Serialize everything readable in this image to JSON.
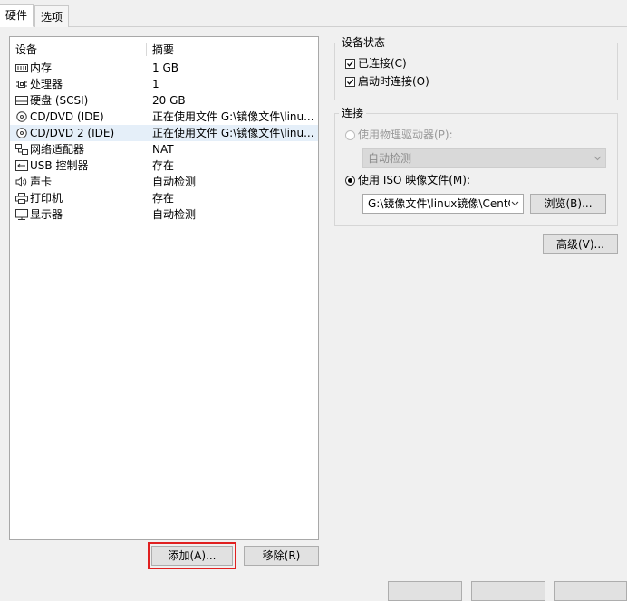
{
  "tabs": [
    {
      "label": "硬件",
      "active": true
    },
    {
      "label": "选项",
      "active": false
    }
  ],
  "device_list": {
    "columns": [
      "设备",
      "摘要"
    ],
    "rows": [
      {
        "icon": "memory-icon",
        "name": "内存",
        "summary": "1 GB",
        "selected": false
      },
      {
        "icon": "cpu-icon",
        "name": "处理器",
        "summary": "1",
        "selected": false
      },
      {
        "icon": "hard-disk-icon",
        "name": "硬盘 (SCSI)",
        "summary": "20 GB",
        "selected": false
      },
      {
        "icon": "cd-dvd-icon",
        "name": "CD/DVD (IDE)",
        "summary": "正在使用文件 G:\\镜像文件\\linu...",
        "selected": false
      },
      {
        "icon": "cd-dvd-icon",
        "name": "CD/DVD 2 (IDE)",
        "summary": "正在使用文件 G:\\镜像文件\\linu...",
        "selected": true
      },
      {
        "icon": "network-adapter-icon",
        "name": "网络适配器",
        "summary": "NAT",
        "selected": false
      },
      {
        "icon": "usb-icon",
        "name": "USB 控制器",
        "summary": "存在",
        "selected": false
      },
      {
        "icon": "sound-card-icon",
        "name": "声卡",
        "summary": "自动检测",
        "selected": false
      },
      {
        "icon": "printer-icon",
        "name": "打印机",
        "summary": "存在",
        "selected": false
      },
      {
        "icon": "display-icon",
        "name": "显示器",
        "summary": "自动检测",
        "selected": false
      }
    ]
  },
  "buttons": {
    "add": "添加(A)...",
    "remove": "移除(R)",
    "browse": "浏览(B)...",
    "advanced": "高级(V)..."
  },
  "device_status": {
    "title": "设备状态",
    "connected": {
      "label": "已连接(C)",
      "checked": true
    },
    "connect_on_power_on": {
      "label": "启动时连接(O)",
      "checked": true
    }
  },
  "connection": {
    "title": "连接",
    "physical_drive": {
      "label": "使用物理驱动器(P):",
      "selected": false,
      "enabled": false,
      "value": "自动检测"
    },
    "iso_image": {
      "label": "使用 ISO 映像文件(M):",
      "selected": true,
      "value": "G:\\镜像文件\\linux镜像\\CentC"
    }
  },
  "colors": {
    "highlight_outline": "#e02020",
    "selected_row": "#e5eff9",
    "window_bg": "#f0f0f0"
  }
}
